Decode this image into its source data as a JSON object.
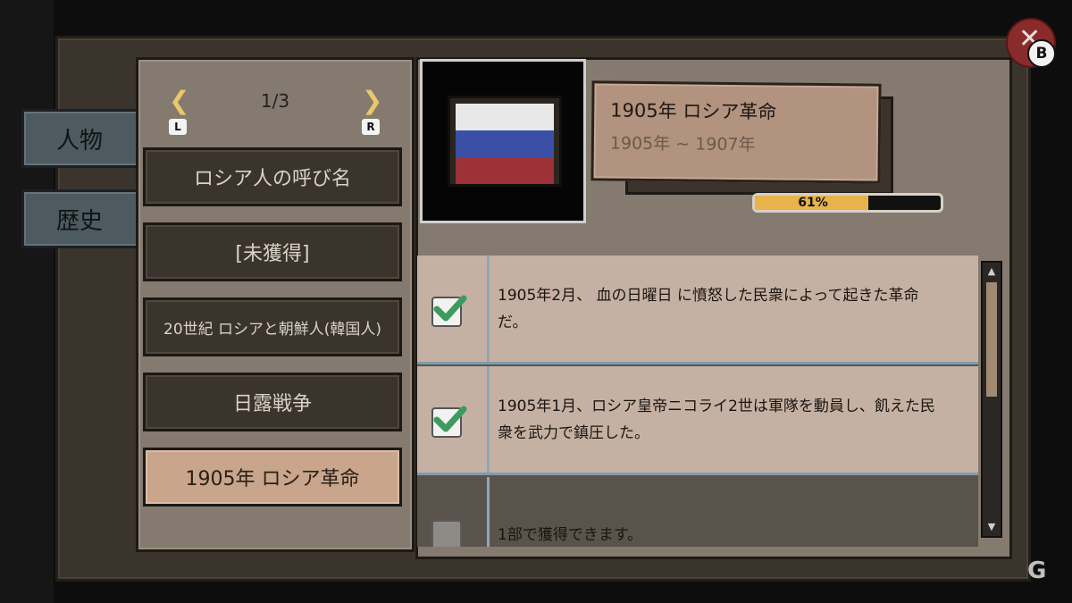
{
  "tabs": [
    {
      "label": "人物"
    },
    {
      "label": "歴史"
    }
  ],
  "pager": {
    "text": "1/3",
    "left_key": "L",
    "right_key": "R"
  },
  "list": [
    {
      "label": "ロシア人の呼び名"
    },
    {
      "label": "[未獲得]"
    },
    {
      "label": "20世紀 ロシアと朝鮮人(韓国人)"
    },
    {
      "label": "日露戦争"
    },
    {
      "label": "1905年 ロシア革命"
    }
  ],
  "event": {
    "title": "1905年 ロシア革命",
    "period": "1905年 ~ 1907年",
    "progress_text": "61%",
    "progress_fraction": 0.61
  },
  "facts": [
    {
      "checked": true,
      "text": "1905年2月、 血の日曜日 に憤怒した民衆によって起きた革命だ。"
    },
    {
      "checked": true,
      "text": "1905年1月、ロシア皇帝ニコライ2世は軍隊を動員し、飢えた民衆を武力で鎮圧した。"
    },
    {
      "checked": false,
      "text": "1部で獲得できます。"
    }
  ],
  "close_button": {
    "badge": "B"
  },
  "colors": {
    "flag_white": "#e8e8e8",
    "flag_blue": "#3a4fa5",
    "flag_red": "#9c3137",
    "progress": "#e7b34a"
  },
  "icons": [
    "close-icon",
    "check-icon",
    "arrow-left-icon",
    "arrow-right-icon",
    "scroll-up-icon",
    "scroll-down-icon"
  ]
}
